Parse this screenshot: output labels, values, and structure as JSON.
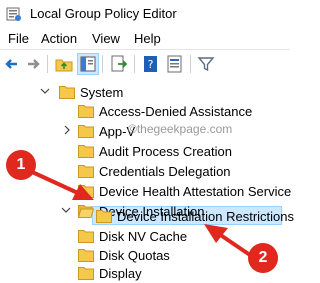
{
  "window": {
    "title": "Local Group Policy Editor"
  },
  "menu": {
    "items": [
      "File",
      "Action",
      "View",
      "Help"
    ]
  },
  "toolbar": {
    "buttons": [
      "back-icon",
      "forward-icon",
      "up-folder-icon",
      "show-hide-tree-icon",
      "export-list-icon",
      "help-icon",
      "properties-icon",
      "filter-icon"
    ]
  },
  "tree": {
    "items": [
      {
        "label": "System"
      },
      {
        "label": "Access-Denied Assistance"
      },
      {
        "label": "App-V"
      },
      {
        "label": "Audit Process Creation"
      },
      {
        "label": "Credentials Delegation"
      },
      {
        "label": "Device Health Attestation Service"
      },
      {
        "label": "Device Installation"
      },
      {
        "label": "Device Installation Restrictions"
      },
      {
        "label": "Disk NV Cache"
      },
      {
        "label": "Disk Quotas"
      },
      {
        "label": "Display"
      }
    ]
  },
  "watermark": "©thegeekpage.com",
  "annotations": {
    "step1": "1",
    "step2": "2"
  },
  "colors": {
    "accent_red": "#e0281f",
    "selection": "#cce8ff",
    "folder": "#f5c84c"
  }
}
